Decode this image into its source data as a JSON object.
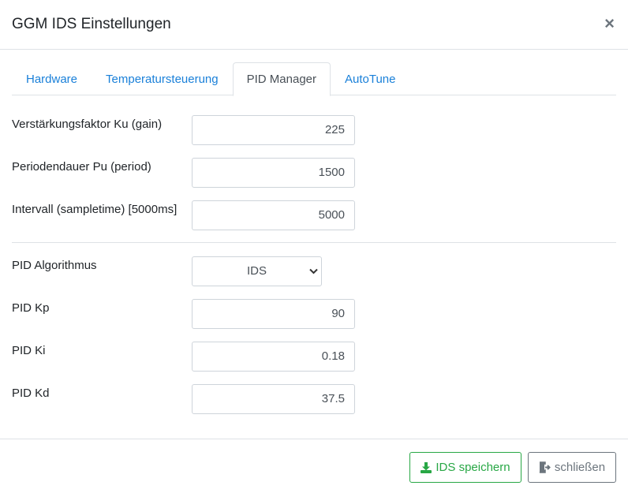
{
  "modal": {
    "title": "GGM IDS Einstellungen",
    "close_symbol": "×"
  },
  "tabs": [
    {
      "label": "Hardware",
      "active": false
    },
    {
      "label": "Temperatursteuerung",
      "active": false
    },
    {
      "label": "PID Manager",
      "active": true
    },
    {
      "label": "AutoTune",
      "active": false
    }
  ],
  "autotune_fields": [
    {
      "label": "Verstärkungsfaktor Ku (gain)",
      "value": "225"
    },
    {
      "label": "Periodendauer Pu (period)",
      "value": "1500"
    },
    {
      "label": "Intervall (sampletime) [5000ms]",
      "value": "5000"
    }
  ],
  "pid": {
    "algorithm_label": "PID Algorithmus",
    "algorithm_value": "IDS",
    "fields": [
      {
        "label": "PID Kp",
        "value": "90"
      },
      {
        "label": "PID Ki",
        "value": "0.18"
      },
      {
        "label": "PID Kd",
        "value": "37.5"
      }
    ]
  },
  "footer": {
    "save_label": "IDS speichern",
    "close_label": "schließen"
  },
  "colors": {
    "link": "#1a80d9",
    "success": "#28a745",
    "secondary": "#6c757d",
    "border": "#dee2e6"
  },
  "icons": {
    "close": "close-icon",
    "select_arrow": "chevron-down-icon",
    "save": "download-icon",
    "exit": "sign-out-icon"
  }
}
